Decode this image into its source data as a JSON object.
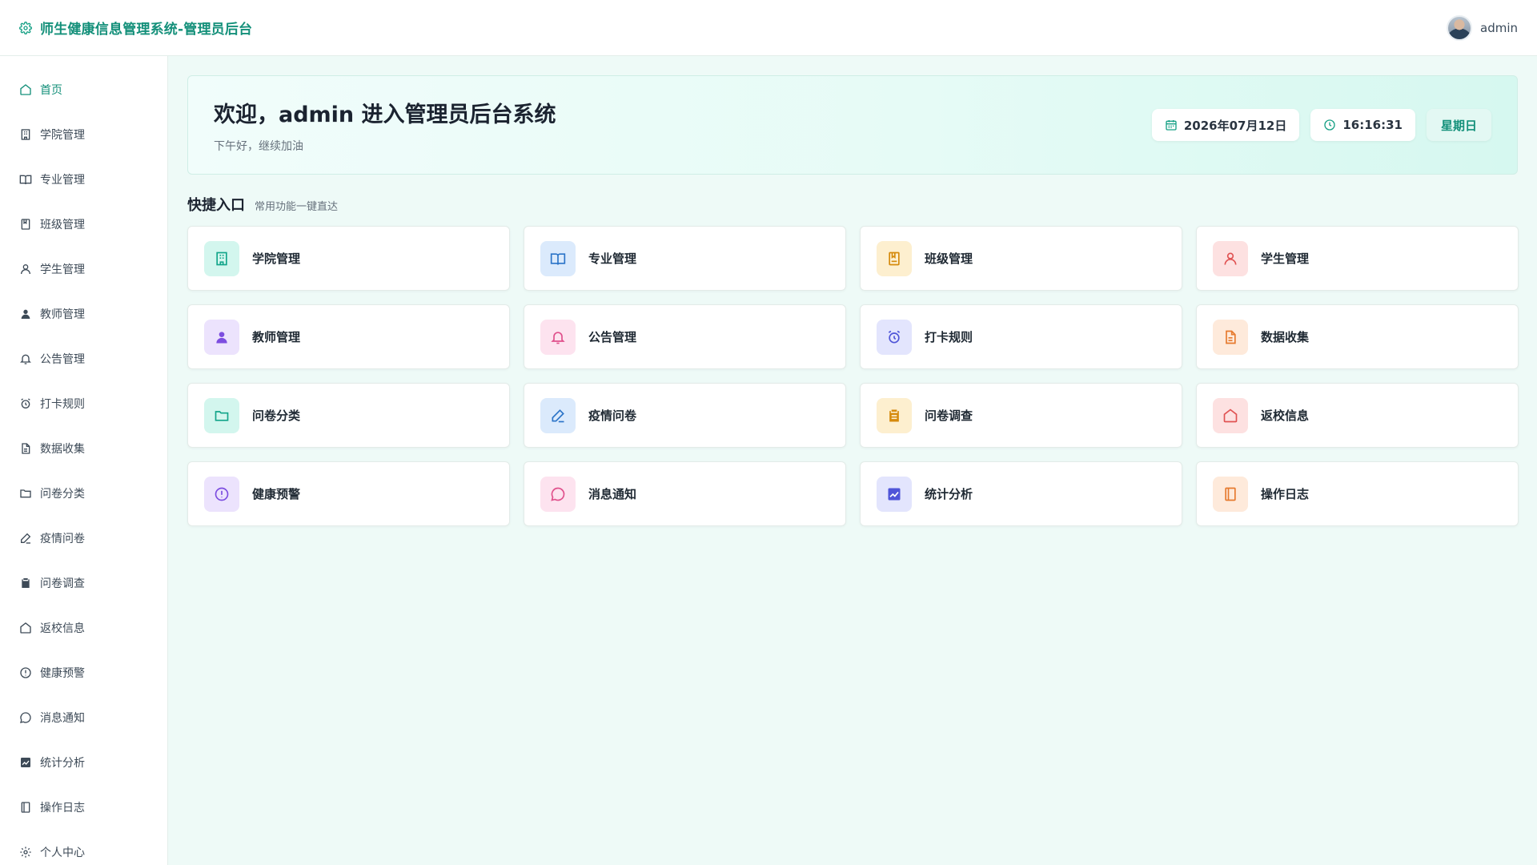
{
  "header": {
    "title": "师生健康信息管理系统-管理员后台",
    "username": "admin"
  },
  "sidebar": {
    "items": [
      {
        "label": "首页"
      },
      {
        "label": "学院管理"
      },
      {
        "label": "专业管理"
      },
      {
        "label": "班级管理"
      },
      {
        "label": "学生管理"
      },
      {
        "label": "教师管理"
      },
      {
        "label": "公告管理"
      },
      {
        "label": "打卡规则"
      },
      {
        "label": "数据收集"
      },
      {
        "label": "问卷分类"
      },
      {
        "label": "疫情问卷"
      },
      {
        "label": "问卷调查"
      },
      {
        "label": "返校信息"
      },
      {
        "label": "健康预警"
      },
      {
        "label": "消息通知"
      },
      {
        "label": "统计分析"
      },
      {
        "label": "操作日志"
      },
      {
        "label": "个人中心"
      }
    ]
  },
  "welcome": {
    "title": "欢迎，admin 进入管理员后台系统",
    "subtitle": "下午好，继续加油",
    "date": "2026年07月12日",
    "time": "16:16:31",
    "weekday": "星期日"
  },
  "quick": {
    "title": "快捷入口",
    "subtitle": "常用功能一键直达",
    "cards": [
      {
        "label": "学院管理"
      },
      {
        "label": "专业管理"
      },
      {
        "label": "班级管理"
      },
      {
        "label": "学生管理"
      },
      {
        "label": "教师管理"
      },
      {
        "label": "公告管理"
      },
      {
        "label": "打卡规则"
      },
      {
        "label": "数据收集"
      },
      {
        "label": "问卷分类"
      },
      {
        "label": "疫情问卷"
      },
      {
        "label": "问卷调查"
      },
      {
        "label": "返校信息"
      },
      {
        "label": "健康预警"
      },
      {
        "label": "消息通知"
      },
      {
        "label": "统计分析"
      },
      {
        "label": "操作日志"
      }
    ]
  },
  "colors": {
    "accent": "#14907a",
    "background": "#eefaf7"
  }
}
